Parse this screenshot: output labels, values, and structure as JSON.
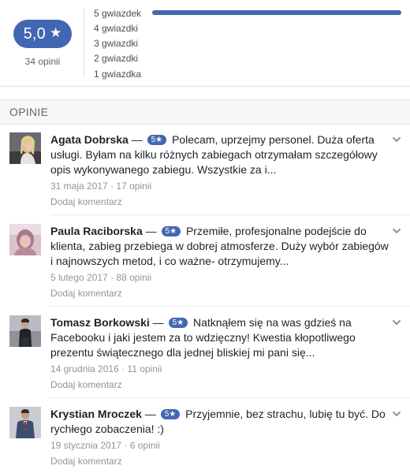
{
  "summary": {
    "score": "5,0",
    "star_glyph": "★",
    "review_count": "34 opinii",
    "rating_rows": [
      {
        "label": "5 gwiazdek",
        "fraction": 1.0
      },
      {
        "label": "4 gwiazdki",
        "fraction": 0.0
      },
      {
        "label": "3 gwiazdki",
        "fraction": 0.0
      },
      {
        "label": "2 gwiazdki",
        "fraction": 0.0
      },
      {
        "label": "1 gwiazdka",
        "fraction": 0.0
      }
    ],
    "accent_color": "#4267b2"
  },
  "section": {
    "title": "OPINIE"
  },
  "reviews": [
    {
      "name": "Agata Dobrska",
      "dash": " — ",
      "badge": "5★",
      "text": "Polecam, uprzejmy personel. Duża oferta usługi. Byłam na kilku różnych zabiegach otrzymałam szczegółowy opis wykonywanego zabiegu. Wszystkie za i...",
      "date": "31 maja 2017",
      "meta_sep": " · ",
      "user_reviews": "17 opinii",
      "comment": "Dodaj komentarz"
    },
    {
      "name": "Paula Raciborska",
      "dash": " — ",
      "badge": "5★",
      "text": "Przemiłe, profesjonalne podejście do klienta, zabieg przebiega w dobrej atmosferze. Duży wybór zabiegów i najnowszych metod, i co ważne- otrzymujemy...",
      "date": "5 lutego 2017",
      "meta_sep": " · ",
      "user_reviews": "88 opinii",
      "comment": "Dodaj komentarz"
    },
    {
      "name": "Tomasz Borkowski",
      "dash": " — ",
      "badge": "5★",
      "text": "Natknąłem się na was gdzieś na Facebooku i jaki jestem za to wdzięczny! Kwestia kłopotliwego prezentu świątecznego dla jednej bliskiej mi pani się...",
      "date": "14 grudnia 2016",
      "meta_sep": " · ",
      "user_reviews": "11 opinii",
      "comment": "Dodaj komentarz"
    },
    {
      "name": "Krystian Mroczek",
      "dash": " — ",
      "badge": "5★",
      "text": "Przyjemnie, bez strachu, lubię tu być. Do rychłego zobaczenia! :)",
      "date": "19 stycznia 2017",
      "meta_sep": " · ",
      "user_reviews": "6 opinii",
      "comment": "Dodaj komentarz"
    }
  ]
}
